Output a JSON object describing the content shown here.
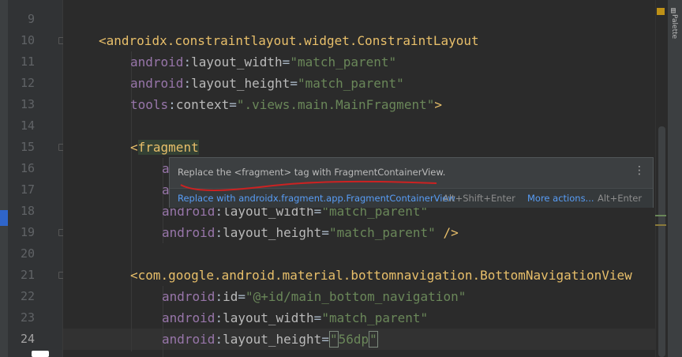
{
  "gutter": {
    "line_numbers": [
      "9",
      "10",
      "11",
      "12",
      "13",
      "14",
      "15",
      "16",
      "17",
      "18",
      "19",
      "20",
      "21",
      "22",
      "23",
      "24"
    ],
    "current_line": "24"
  },
  "code": {
    "l10": {
      "open": "<",
      "tag": "androidx.constraintlayout.widget.ConstraintLayout"
    },
    "l11": {
      "ns": "android",
      "sep": ":",
      "attr": "layout_width",
      "eq": "=",
      "val": "\"match_parent\""
    },
    "l12": {
      "ns": "android",
      "sep": ":",
      "attr": "layout_height",
      "eq": "=",
      "val": "\"match_parent\""
    },
    "l13": {
      "ns": "tools",
      "sep": ":",
      "attr": "context",
      "eq": "=",
      "val": "\".views.main.MainFragment\"",
      "close": ">"
    },
    "l15": {
      "open": "<",
      "tag": "fragment"
    },
    "l16": {
      "partial": "a"
    },
    "l17": {
      "partial": "a"
    },
    "l18": {
      "ns": "android",
      "sep": ":",
      "attr": "layout_width",
      "eq": "=",
      "val": "\"match_parent\""
    },
    "l19": {
      "ns": "android",
      "sep": ":",
      "attr": "layout_height",
      "eq": "=",
      "val": "\"match_parent\"",
      "close": " />"
    },
    "l21": {
      "open": "<",
      "tag": "com.google.android.material.bottomnavigation.BottomNavigationView"
    },
    "l22": {
      "ns": "android",
      "sep": ":",
      "attr": "id",
      "eq": "=",
      "val": "\"@+id/main_bottom_navigation\""
    },
    "l23": {
      "ns": "android",
      "sep": ":",
      "attr": "layout_width",
      "eq": "=",
      "val": "\"match_parent\""
    },
    "l24": {
      "ns": "android",
      "sep": ":",
      "attr": "layout_height",
      "eq": "=",
      "q1": "\"",
      "val": "56dp",
      "q2": "\""
    }
  },
  "popup": {
    "message": "Replace the <fragment> tag with FragmentContainerView.",
    "menu_icon": "more-vertical-icon",
    "fix_label": "Replace with androidx.fragment.app.FragmentContainerView",
    "fix_shortcut": "Alt+Shift+Enter",
    "more_label": "More actions...",
    "more_shortcut": "Alt+Enter"
  },
  "side_panel": {
    "label": "Palette"
  },
  "colors": {
    "tag": "#e8bf6a",
    "namespace": "#9876aa",
    "value": "#6a8759",
    "link": "#589df6",
    "squiggle": "#cc2222"
  }
}
